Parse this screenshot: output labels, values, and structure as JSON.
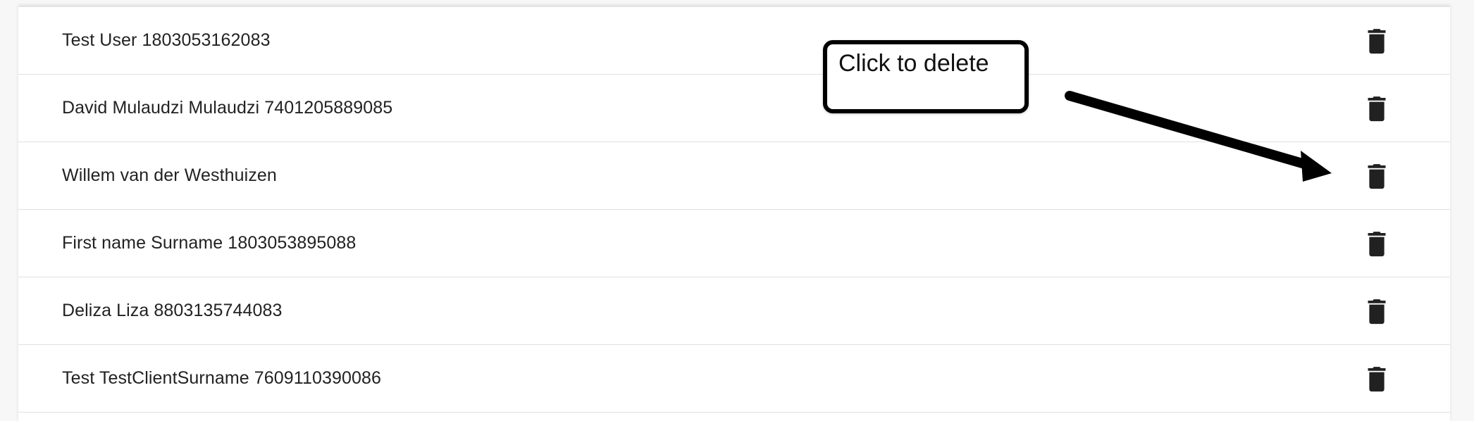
{
  "list": {
    "rows": [
      {
        "label": "Test User 1803053162083",
        "action_icon": "trash-icon"
      },
      {
        "label": "David Mulaudzi Mulaudzi 7401205889085",
        "action_icon": "trash-icon"
      },
      {
        "label": "Willem van der Westhuizen",
        "action_icon": "trash-icon"
      },
      {
        "label": "First name Surname 1803053895088",
        "action_icon": "trash-icon"
      },
      {
        "label": "Deliza Liza 8803135744083",
        "action_icon": "trash-icon"
      },
      {
        "label": "Test TestClientSurname 7609110390086",
        "action_icon": "trash-icon"
      }
    ]
  },
  "annotation": {
    "text": "Click to delete",
    "arrow_color": "#000000"
  },
  "colors": {
    "page_background": "#f7f7f7",
    "row_background": "#ffffff",
    "divider": "#e0e0e0",
    "icon": "#212121",
    "text": "#222222"
  }
}
